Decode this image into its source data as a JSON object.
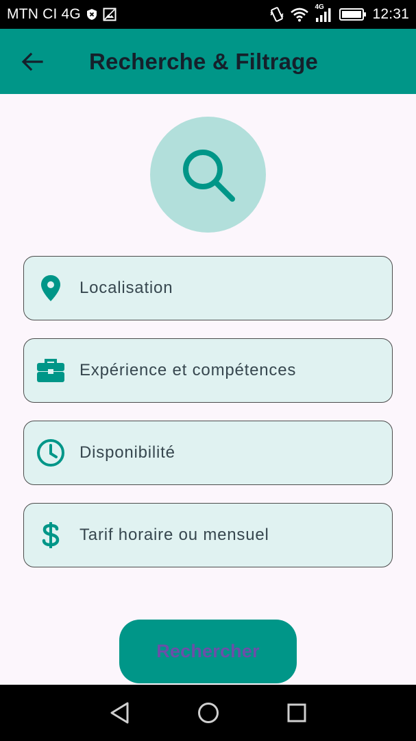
{
  "status_bar": {
    "carrier": "MTN CI 4G",
    "network_type": "4G",
    "time": "12:31",
    "icons": [
      "shield-x-icon",
      "image-icon",
      "vibrate-icon",
      "wifi-icon",
      "signal-icon",
      "battery-icon"
    ]
  },
  "app_bar": {
    "title": "Recherche & Filtrage",
    "back_icon": "arrow-left-icon"
  },
  "hero": {
    "icon": "search-icon"
  },
  "filters": [
    {
      "label": "Localisation",
      "icon": "location-pin-icon"
    },
    {
      "label": "Expérience et compétences",
      "icon": "briefcase-icon"
    },
    {
      "label": "Disponibilité",
      "icon": "clock-icon"
    },
    {
      "label": "Tarif horaire ou mensuel",
      "icon": "dollar-icon"
    }
  ],
  "search_button": {
    "label": "Rechercher"
  },
  "colors": {
    "primary": "#009688",
    "hero_circle": "#b2dfdb",
    "card_background": "#e0f2f1",
    "page_background": "#fcf6fc",
    "button_text": "#6b4fa8"
  },
  "nav_bar": {
    "buttons": [
      "back-triangle-icon",
      "home-circle-icon",
      "recents-square-icon"
    ]
  }
}
